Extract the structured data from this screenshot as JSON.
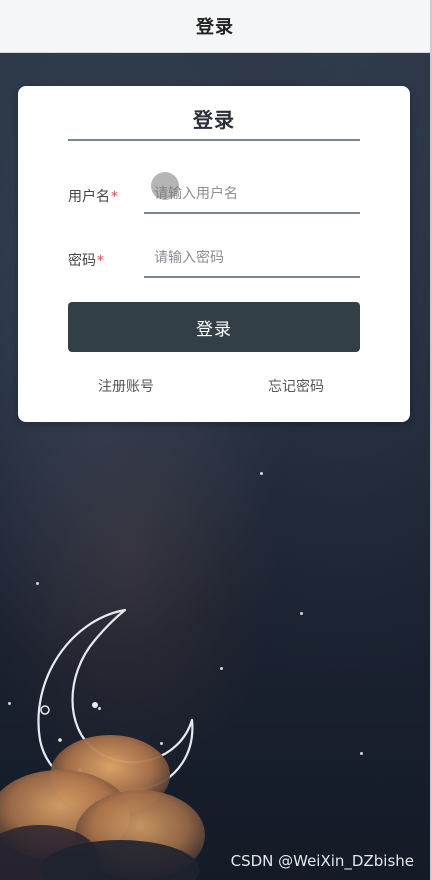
{
  "window": {
    "title": "登录"
  },
  "login_card": {
    "title": "登录",
    "username": {
      "label": "用户名",
      "required_mark": "*",
      "placeholder": "请输入用户名",
      "value": ""
    },
    "password": {
      "label": "密码",
      "required_mark": "*",
      "placeholder": "请输入密码",
      "value": ""
    },
    "submit_label": "登录",
    "register_link": "注册账号",
    "forgot_link": "忘记密码"
  },
  "watermark": "CSDN @WeiXin_DZbishe",
  "colors": {
    "button": "#333f47",
    "required": "#e04a4a",
    "background": "#1a2230"
  },
  "icons": [
    "moon-illustration",
    "cloud-illustration"
  ]
}
